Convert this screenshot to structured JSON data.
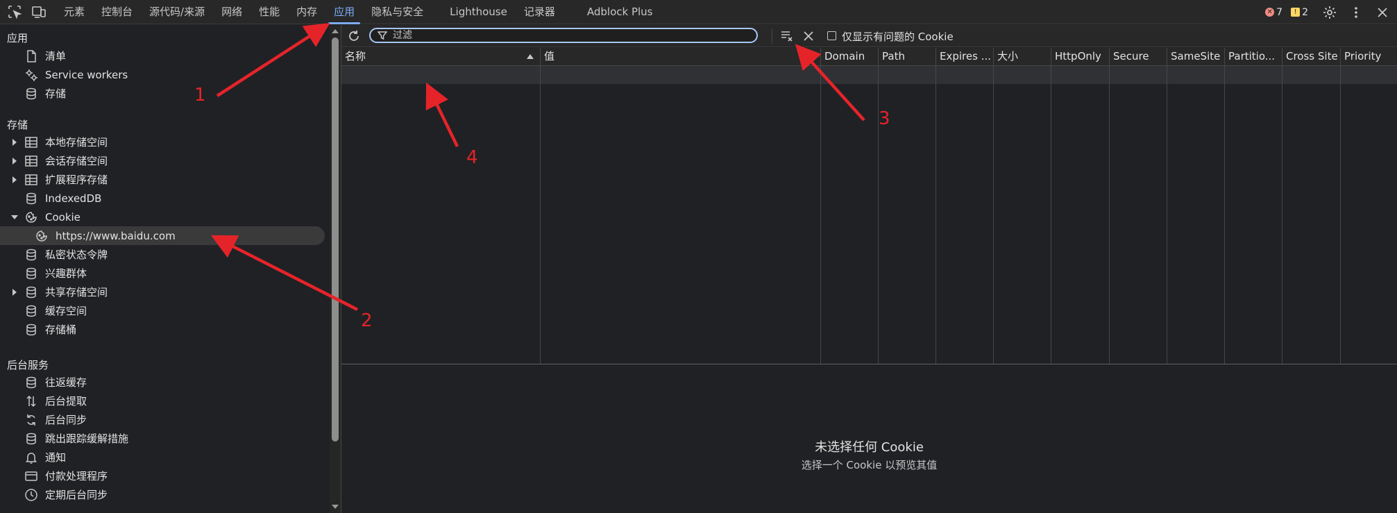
{
  "tabs": [
    "元素",
    "控制台",
    "源代码/来源",
    "网络",
    "性能",
    "内存",
    "应用",
    "隐私与安全",
    "Lighthouse",
    "记录器",
    "Adblock Plus"
  ],
  "active_tab": "应用",
  "status": {
    "errors": "7",
    "warnings": "2"
  },
  "sidebar": {
    "sections": [
      "应用",
      "存储",
      "后台服务"
    ],
    "app_items": [
      "清单",
      "Service workers",
      "存储"
    ],
    "storage_items": [
      "本地存储空间",
      "会话存储空间",
      "扩展程序存储",
      "IndexedDB",
      "Cookie",
      "https://www.baidu.com",
      "私密状态令牌",
      "兴趣群体",
      "共享存储空间",
      "缓存空间",
      "存储桶"
    ],
    "bg_items": [
      "往返缓存",
      "后台提取",
      "后台同步",
      "跳出跟踪缓解措施",
      "通知",
      "付款处理程序",
      "定期后台同步"
    ],
    "selected": "https://www.baidu.com"
  },
  "toolbar": {
    "filter_placeholder": "过滤",
    "only_issues_label": "仅显示有问题的 Cookie"
  },
  "table": {
    "columns": [
      "名称",
      "值",
      "Domain",
      "Path",
      "Expires ...",
      "大小",
      "HttpOnly",
      "Secure",
      "SameSite",
      "Partitio...",
      "Cross Site",
      "Priority"
    ],
    "rows": []
  },
  "empty_state": {
    "title": "未选择任何 Cookie",
    "subtitle": "选择一个 Cookie 以预览其值"
  },
  "annotations": {
    "numbers": [
      "1",
      "2",
      "3",
      "4"
    ],
    "color": "#e5242a"
  }
}
